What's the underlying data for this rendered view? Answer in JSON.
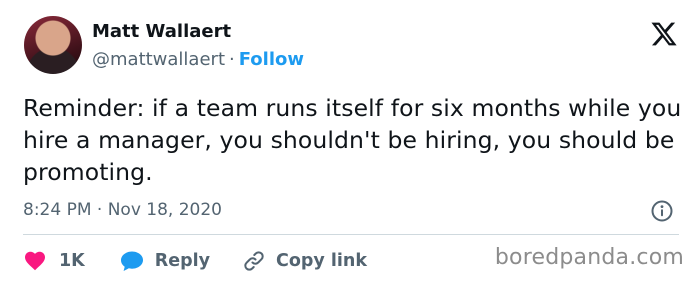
{
  "author": {
    "name": "Matt Wallaert",
    "handle": "@mattwallaert",
    "separator": "·",
    "follow_label": "Follow"
  },
  "tweet": {
    "text": "Reminder: if a team runs itself for six months while you hire a manager, you shouldn't be hiring, you should be promoting.",
    "timestamp": "8:24 PM · Nov 18, 2020"
  },
  "actions": {
    "like_count": "1K",
    "reply_label": "Reply",
    "copy_link_label": "Copy link"
  },
  "watermark": "boredpanda.com",
  "icons": {
    "like": "heart-icon",
    "reply": "speech-bubble-icon",
    "copy": "link-icon",
    "info": "info-icon",
    "logo": "x-logo-icon"
  },
  "colors": {
    "accent": "#1d9bf0",
    "like": "#f91880",
    "muted": "#536471",
    "text": "#0f1419"
  }
}
